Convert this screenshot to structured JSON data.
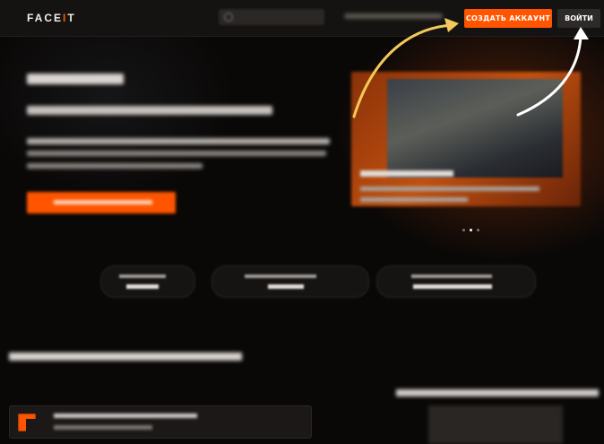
{
  "header": {
    "logo_text": "FACE",
    "logo_accent": "I",
    "logo_tail": "T",
    "create_account_label": "СОЗДАТЬ АККАУНТ",
    "login_label": "ВОЙТИ"
  },
  "colors": {
    "accent": "#ff5500",
    "arrow_yellow": "#f3c95a",
    "arrow_white": "#ffffff",
    "background": "#0a0807"
  },
  "promo": {
    "carousel_slides": 3,
    "active_slide": 2
  },
  "icons": [
    "search-icon",
    "facet-game-icon",
    "annotation-arrow"
  ]
}
